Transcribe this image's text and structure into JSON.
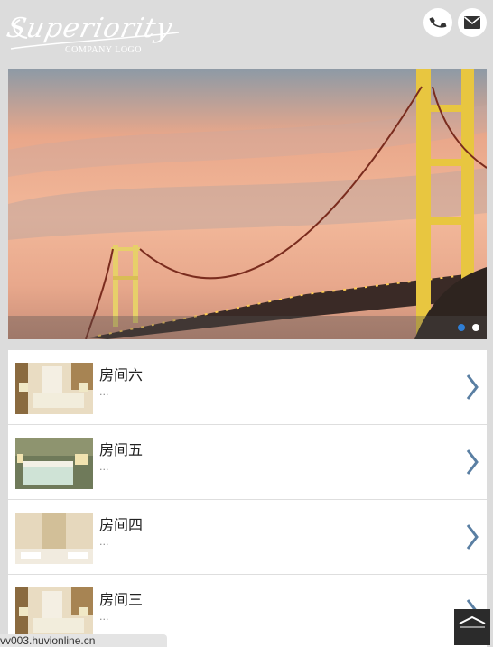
{
  "header": {
    "logo_script": "Superiority",
    "logo_sub": "COMPANY LOGO"
  },
  "icons": {
    "phone": "phone-icon",
    "mail": "mail-icon",
    "chevron": "chevron-right-icon",
    "back_to_top": "chevron-up-icon"
  },
  "banner": {
    "slides": 2,
    "active_slide": 1
  },
  "rooms": [
    {
      "title": "房间六",
      "desc": "..."
    },
    {
      "title": "房间五",
      "desc": "..."
    },
    {
      "title": "房间四",
      "desc": "..."
    },
    {
      "title": "房间三",
      "desc": "..."
    }
  ],
  "status": {
    "url": "vv003.huvionline.cn"
  },
  "colors": {
    "background": "#dcdcdc",
    "active_dot": "#2f7fd6",
    "chevron": "#5a7fa3"
  }
}
